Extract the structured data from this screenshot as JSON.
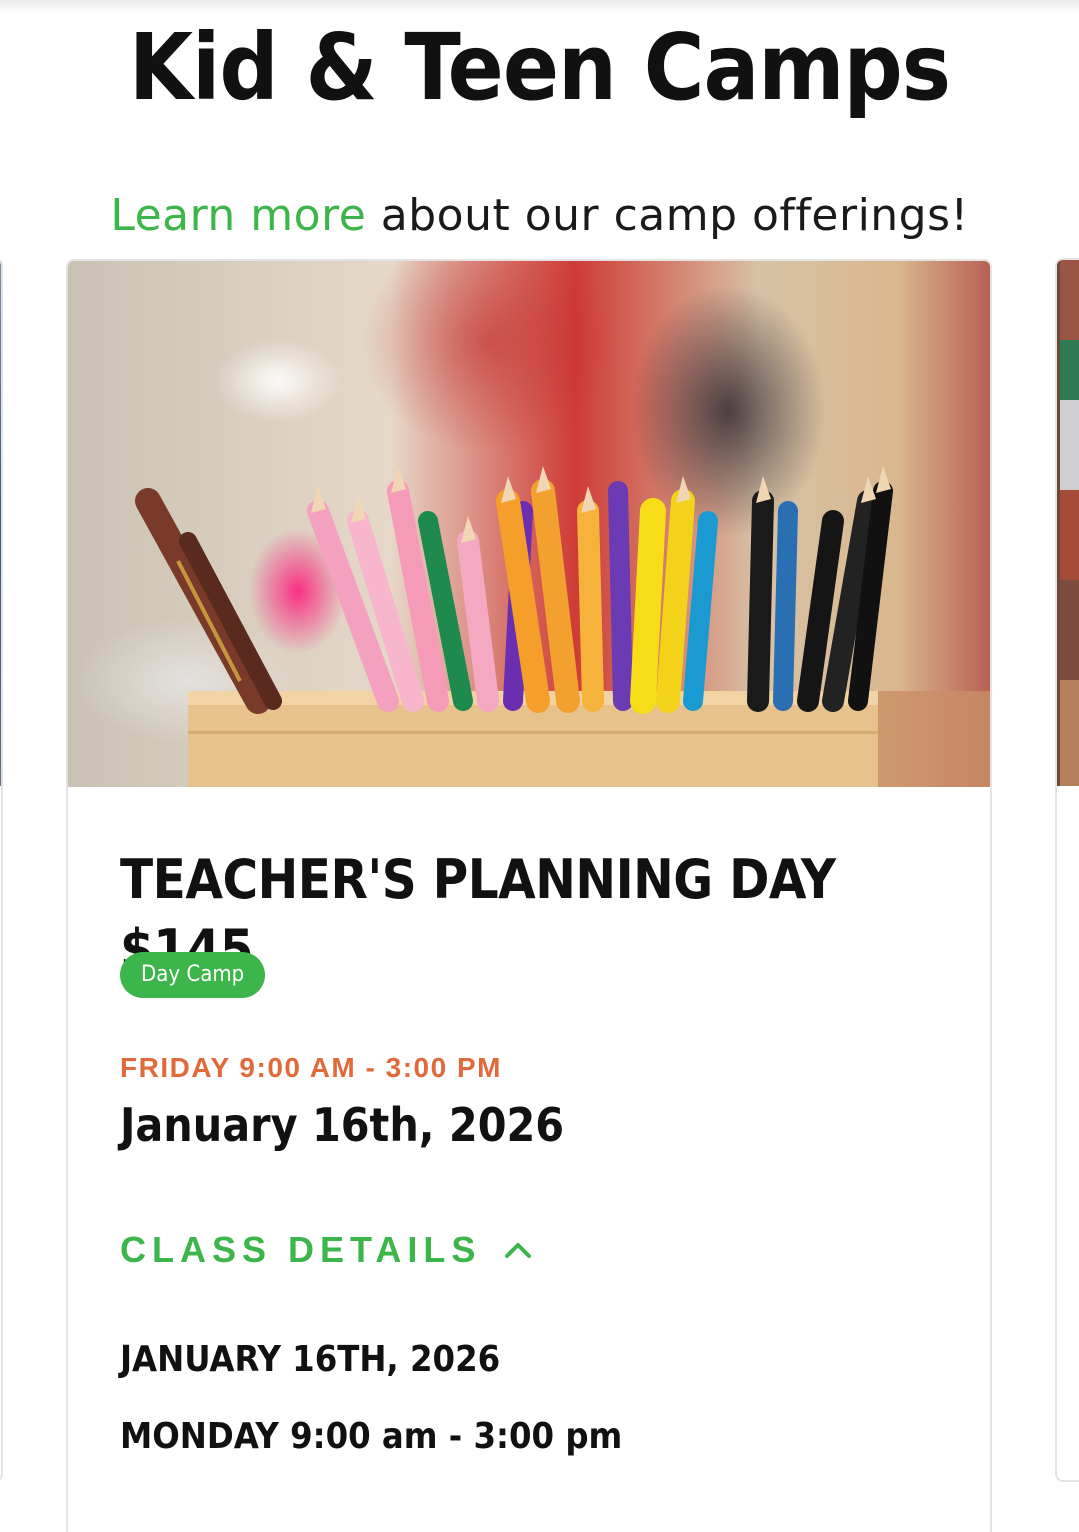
{
  "header": {
    "title": "Kid & Teen Camps",
    "subtitle_link": "Learn more",
    "subtitle_rest": " about our camp offerings!"
  },
  "card": {
    "image_alt": "Colored pencils in a wooden holder",
    "title": "TEACHER'S PLANNING DAY $145",
    "badge": "Day Camp",
    "time_label": "FRIDAY 9:00 AM - 3:00 PM",
    "date": "January 16th, 2026",
    "details_toggle": "CLASS DETAILS",
    "details_icon": "chevron-up-icon",
    "details": {
      "date_line": "JANUARY 16TH, 2026",
      "time_line": "MONDAY 9:00 am - 3:00 pm"
    }
  },
  "colors": {
    "accent_green": "#3cb54a",
    "time_orange": "#e06a3b",
    "text_dark": "#111111"
  }
}
